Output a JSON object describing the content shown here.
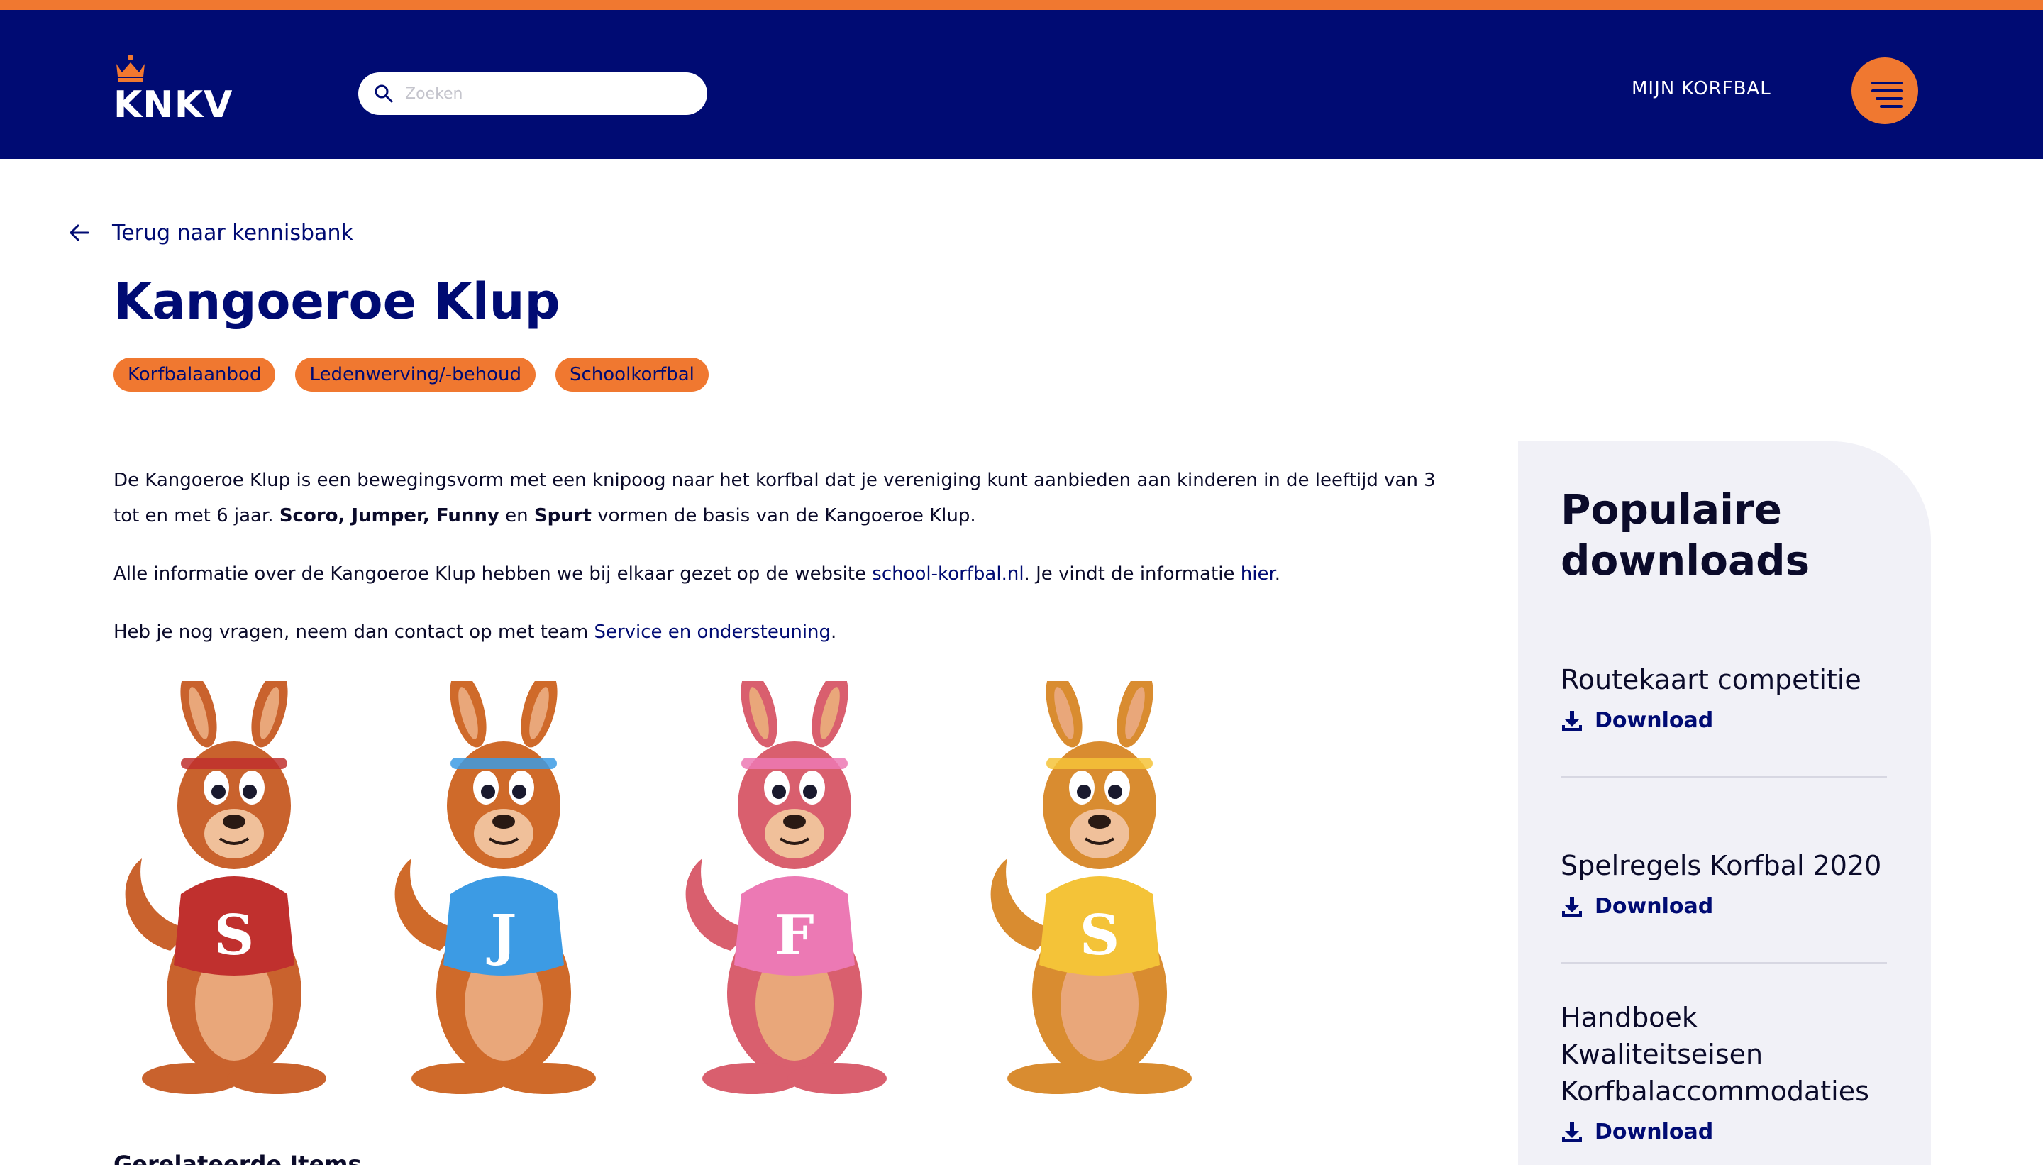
{
  "brand": {
    "name": "KNKV",
    "primary_color": "#000b73",
    "accent_color": "#f07830"
  },
  "header": {
    "search": {
      "placeholder": "Zoeken"
    },
    "account_link": "MIJN KORFBAL",
    "menu_icon": "hamburger-menu-icon"
  },
  "back_link": {
    "label": "Terug naar kennisbank",
    "icon": "arrow-left-icon"
  },
  "article": {
    "title": "Kangoeroe Klup",
    "tags": [
      "Korfbalaanbod",
      "Ledenwerving/-behoud",
      "Schoolkorfbal"
    ],
    "paragraph1": {
      "text_a": "De Kangoeroe Klup is een bewegingsvorm met een knipoog naar het korfbal dat je vereniging kunt aanbieden aan kinderen in de leeftijd van 3 tot en met 6 jaar. ",
      "bold_a": "Scoro, Jumper, Funny",
      "text_b": " en ",
      "bold_b": "Spurt",
      "text_c": " vormen de basis van de Kangoeroe Klup."
    },
    "paragraph2": {
      "text_a": "Alle informatie over de Kangoeroe Klup hebben we bij elkaar gezet op de website ",
      "link_a": "school-korfbal.nl",
      "text_b": ". Je vindt de informatie ",
      "link_b": "hier",
      "text_c": "."
    },
    "paragraph3": {
      "text_a": "Heb je nog vragen, neem dan contact op met team ",
      "link_a": "Service en ondersteuning",
      "text_b": "."
    },
    "mascots": [
      {
        "letter": "S",
        "shirt_color": "#c0302e",
        "body_color": "#c9622d"
      },
      {
        "letter": "J",
        "shirt_color": "#3c9be4",
        "body_color": "#cf6a2a"
      },
      {
        "letter": "F",
        "shirt_color": "#ec79b4",
        "body_color": "#d95f6e"
      },
      {
        "letter": "S",
        "shirt_color": "#f4c338",
        "body_color": "#d98c30"
      }
    ],
    "related_heading": "Gerelateerde Items"
  },
  "sidebar": {
    "title": "Populaire downloads",
    "download_label": "Download",
    "download_icon": "download-icon",
    "items": [
      {
        "title": "Routekaart competitie"
      },
      {
        "title": "Spelregels Korfbal 2020"
      },
      {
        "title": "Handboek Kwaliteitseisen Korfbalaccommodaties"
      }
    ]
  }
}
